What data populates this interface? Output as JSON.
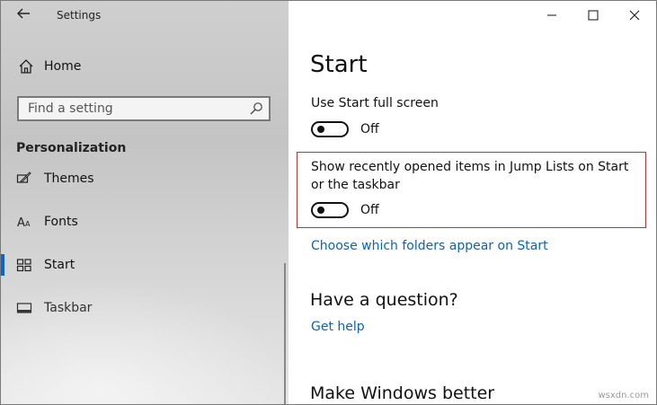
{
  "window": {
    "title": "Settings"
  },
  "sidebar": {
    "home_label": "Home",
    "search_placeholder": "Find a setting",
    "section_title": "Personalization",
    "items": [
      {
        "label": "Themes",
        "icon": "brush-icon"
      },
      {
        "label": "Fonts",
        "icon": "font-icon"
      },
      {
        "label": "Start",
        "icon": "start-menu-icon",
        "selected": true
      },
      {
        "label": "Taskbar",
        "icon": "taskbar-icon"
      }
    ]
  },
  "main": {
    "title": "Start",
    "settings": [
      {
        "label": "Use Start full screen",
        "state": "Off",
        "on": false
      },
      {
        "label": "Show recently opened items in Jump Lists on Start or the taskbar",
        "state": "Off",
        "on": false,
        "highlighted": true
      }
    ],
    "folders_link": "Choose which folders appear on Start",
    "question_heading": "Have a question?",
    "help_link": "Get help",
    "better_heading": "Make Windows better"
  },
  "watermark": "wsxdn.com",
  "colors": {
    "accent": "#0a64d2",
    "link": "#0a63b8",
    "highlight_border": "#c9302c"
  }
}
